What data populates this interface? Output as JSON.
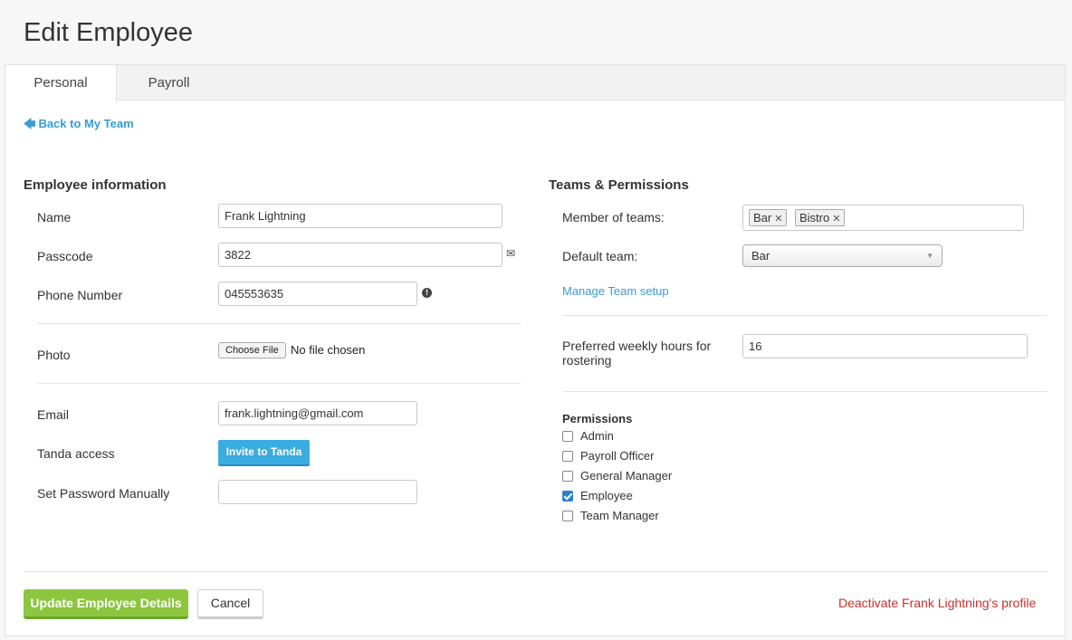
{
  "page": {
    "title": "Edit Employee"
  },
  "tabs": [
    {
      "label": "Personal",
      "active": true
    },
    {
      "label": "Payroll",
      "active": false
    }
  ],
  "back_link": {
    "icon": "arrow-left-icon",
    "label": "Back to My Team"
  },
  "employee_info": {
    "title": "Employee information",
    "name": {
      "label": "Name",
      "value": "Frank Lightning"
    },
    "passcode": {
      "label": "Passcode",
      "value": "3822",
      "icon": "envelope-icon"
    },
    "phone": {
      "label": "Phone Number",
      "value": "045553635",
      "icon": "exclamation-icon"
    },
    "photo": {
      "label": "Photo",
      "button": "Choose File",
      "status": "No file chosen"
    },
    "email": {
      "label": "Email",
      "value": "frank.lightning@gmail.com"
    },
    "tanda_access": {
      "label": "Tanda access",
      "button": "Invite to Tanda"
    },
    "password": {
      "label": "Set Password Manually",
      "value": ""
    }
  },
  "teams_permissions": {
    "title": "Teams & Permissions",
    "member_of_teams": {
      "label": "Member of teams:",
      "teams": [
        "Bar",
        "Bistro"
      ]
    },
    "default_team": {
      "label": "Default team:",
      "value": "Bar"
    },
    "manage_link": "Manage Team setup",
    "preferred_hours": {
      "label_line1": "Preferred weekly hours for",
      "label_line2": "rostering",
      "value": "16"
    },
    "permissions": {
      "title": "Permissions",
      "items": [
        {
          "label": "Admin",
          "checked": false
        },
        {
          "label": "Payroll Officer",
          "checked": false
        },
        {
          "label": "General Manager",
          "checked": false
        },
        {
          "label": "Employee",
          "checked": true
        },
        {
          "label": "Team Manager",
          "checked": false
        }
      ]
    }
  },
  "actions": {
    "update": "Update Employee Details",
    "cancel": "Cancel",
    "deactivate": "Deactivate Frank Lightning's profile"
  },
  "colors": {
    "accent": "#3a9bd5",
    "primary_button": "#8cc63f",
    "invite_button": "#3aace0",
    "danger": "#c9302c"
  }
}
